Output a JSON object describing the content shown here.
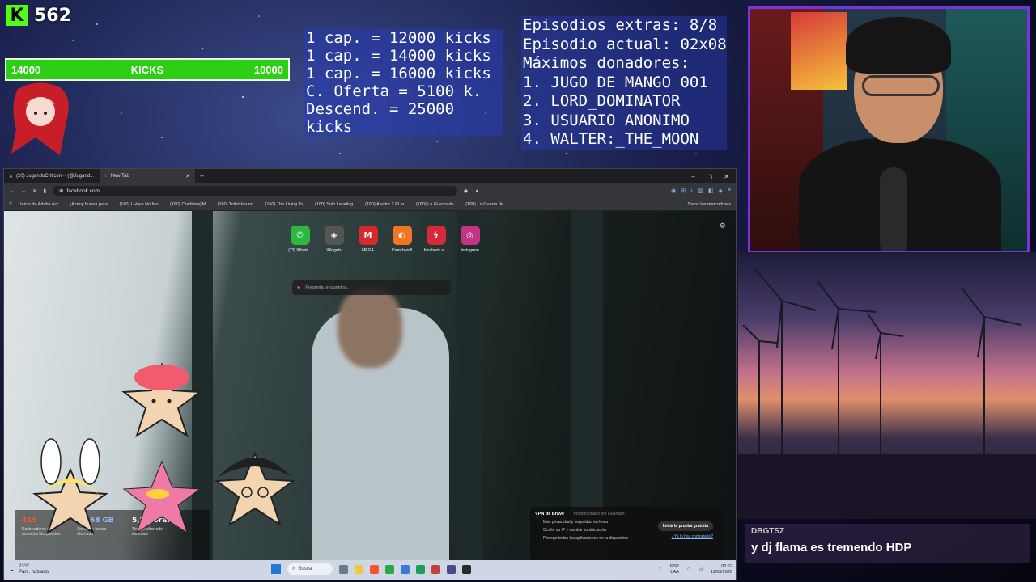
{
  "kick": {
    "logo": "K",
    "count": "562"
  },
  "kicks_goal": {
    "left": "14000",
    "label": "KICKS",
    "right": "10000"
  },
  "prices": [
    "1 cap. = 12000 kicks",
    "1 cap. = 14000 kicks",
    "1 cap. = 16000 kicks",
    "C. Oferta = 5100 k.",
    "Descend. = 25000 kicks"
  ],
  "episodes": {
    "extras": "Episodios extras: 8/8",
    "current": "Episodio actual: 02x08",
    "top_title": "Máximos donadores:",
    "donors": [
      "1. JUGO DE MANGO 001",
      "2. LORD_DOMINATOR",
      "3. USUARIO ANONIMO",
      "4. WALTER:_THE_MOON"
    ]
  },
  "chat": {
    "user": "DBGTSZ",
    "message": "y dj flama es tremendo HDP"
  },
  "browser": {
    "tabs": [
      {
        "label": "(20) JugandoCríticon ·· (@Jugand..."
      },
      {
        "label": "New Tab"
      }
    ],
    "url": "facebook.com",
    "bookmarks": [
      "Inicio de Adobe Acr...",
      "¡A muy buena para...",
      "(160) I Have No Mo...",
      "(160) Credities(/M...",
      "(160) Toilet-bound...",
      "(160) The Living To...",
      "(160) Solo Leveling...",
      "(160) Alastor 2 El m...",
      "(160) La Guerra de...",
      "(160) La Guerra de..."
    ],
    "bookmarks_all": "Todos los marcadores",
    "shortcuts": [
      {
        "label": "(73) Whats...",
        "icon": "whatsapp-icon",
        "glyph": "✆",
        "color": "#2bb741"
      },
      {
        "label": "Widgets",
        "icon": "widgets-icon",
        "glyph": "◈",
        "color": "#555555"
      },
      {
        "label": "MEGA",
        "icon": "mega-icon",
        "glyph": "M",
        "color": "#d9272e"
      },
      {
        "label": "Crunchyroll",
        "icon": "crunchyroll-icon",
        "glyph": "◐",
        "color": "#f47521"
      },
      {
        "label": "facebook sl...",
        "icon": "facebook-icon",
        "glyph": "ϟ",
        "color": "#d42a3a"
      },
      {
        "label": "Instagram",
        "icon": "instagram-icon",
        "glyph": "◎",
        "color": "#c13584"
      }
    ],
    "search_placeholder": "Pregunta, encuentra...",
    "stats": [
      {
        "value": "415",
        "label": "Rastreadores y anuncios bloqueados"
      },
      {
        "value": "10,68 GB",
        "label": "Ancho de banda ahorrado"
      },
      {
        "value": "5,8 Horas",
        "label": "Tiempo ahorrado estimado"
      }
    ],
    "vpn": {
      "title": "VPN de Brave",
      "sponsor": "Proporcionado por Guardian",
      "items": [
        "Más privacidad y seguridad en línea",
        "Oculte su IP y cambie su ubicación",
        "Protege todas las aplicaciones de tu dispositivo"
      ],
      "cta": "Inicia la prueba gratuita",
      "link": "¿Ya lo has contratado?"
    }
  },
  "taskbar": {
    "temp": "23°C",
    "weather": "Parc. nublado",
    "search": "Buscar",
    "lang1": "ESP",
    "lang2": "LAA",
    "time": "02:52",
    "date": "11/03/2026"
  }
}
